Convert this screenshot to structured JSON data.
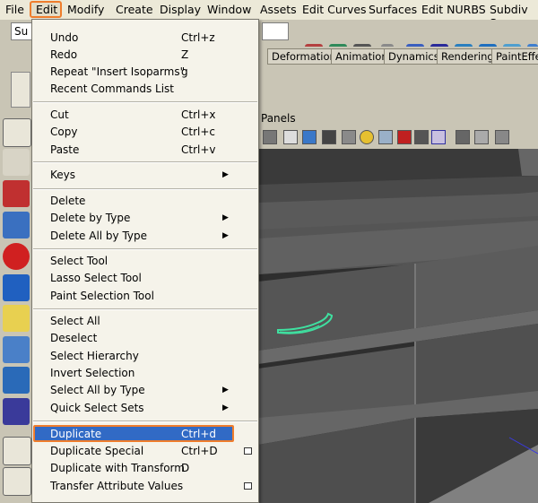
{
  "menubar": {
    "items": [
      "File",
      "Edit",
      "Modify",
      "Create",
      "Display",
      "Window",
      "Assets",
      "Edit Curves",
      "Surfaces",
      "Edit NURBS",
      "Subdiv Su"
    ]
  },
  "toolbar": {
    "field_value": "Su"
  },
  "shelf_tabs": [
    "Deformation",
    "Animation",
    "Dynamics",
    "Rendering",
    "PaintEffe"
  ],
  "panels": {
    "label": "Panels"
  },
  "edit_menu": {
    "items": [
      {
        "label": "Undo",
        "shortcut": "Ctrl+z"
      },
      {
        "label": "Redo",
        "shortcut": "Z"
      },
      {
        "label": "Repeat \"Insert Isoparms\"",
        "shortcut": "g"
      },
      {
        "label": "Recent Commands List",
        "shortcut": ""
      },
      {
        "label": "Cut",
        "shortcut": "Ctrl+x"
      },
      {
        "label": "Copy",
        "shortcut": "Ctrl+c"
      },
      {
        "label": "Paste",
        "shortcut": "Ctrl+v"
      },
      {
        "label": "Keys",
        "shortcut": ""
      },
      {
        "label": "Delete",
        "shortcut": ""
      },
      {
        "label": "Delete by Type",
        "shortcut": ""
      },
      {
        "label": "Delete All by Type",
        "shortcut": ""
      },
      {
        "label": "Select Tool",
        "shortcut": ""
      },
      {
        "label": "Lasso Select Tool",
        "shortcut": ""
      },
      {
        "label": "Paint Selection Tool",
        "shortcut": ""
      },
      {
        "label": "Select All",
        "shortcut": ""
      },
      {
        "label": "Deselect",
        "shortcut": ""
      },
      {
        "label": "Select Hierarchy",
        "shortcut": ""
      },
      {
        "label": "Invert Selection",
        "shortcut": ""
      },
      {
        "label": "Select All by Type",
        "shortcut": ""
      },
      {
        "label": "Quick Select Sets",
        "shortcut": ""
      },
      {
        "label": "Duplicate",
        "shortcut": "Ctrl+d"
      },
      {
        "label": "Duplicate Special",
        "shortcut": "Ctrl+D"
      },
      {
        "label": "Duplicate with Transform",
        "shortcut": "D"
      },
      {
        "label": "Transfer Attribute Values",
        "shortcut": ""
      }
    ],
    "highlighted": "Duplicate"
  },
  "colors": {
    "menu_bg": "#f5f3ea",
    "highlight": "#316ac5",
    "annotation": "#ef7d2c",
    "selection_green": "#3fe0a0"
  }
}
